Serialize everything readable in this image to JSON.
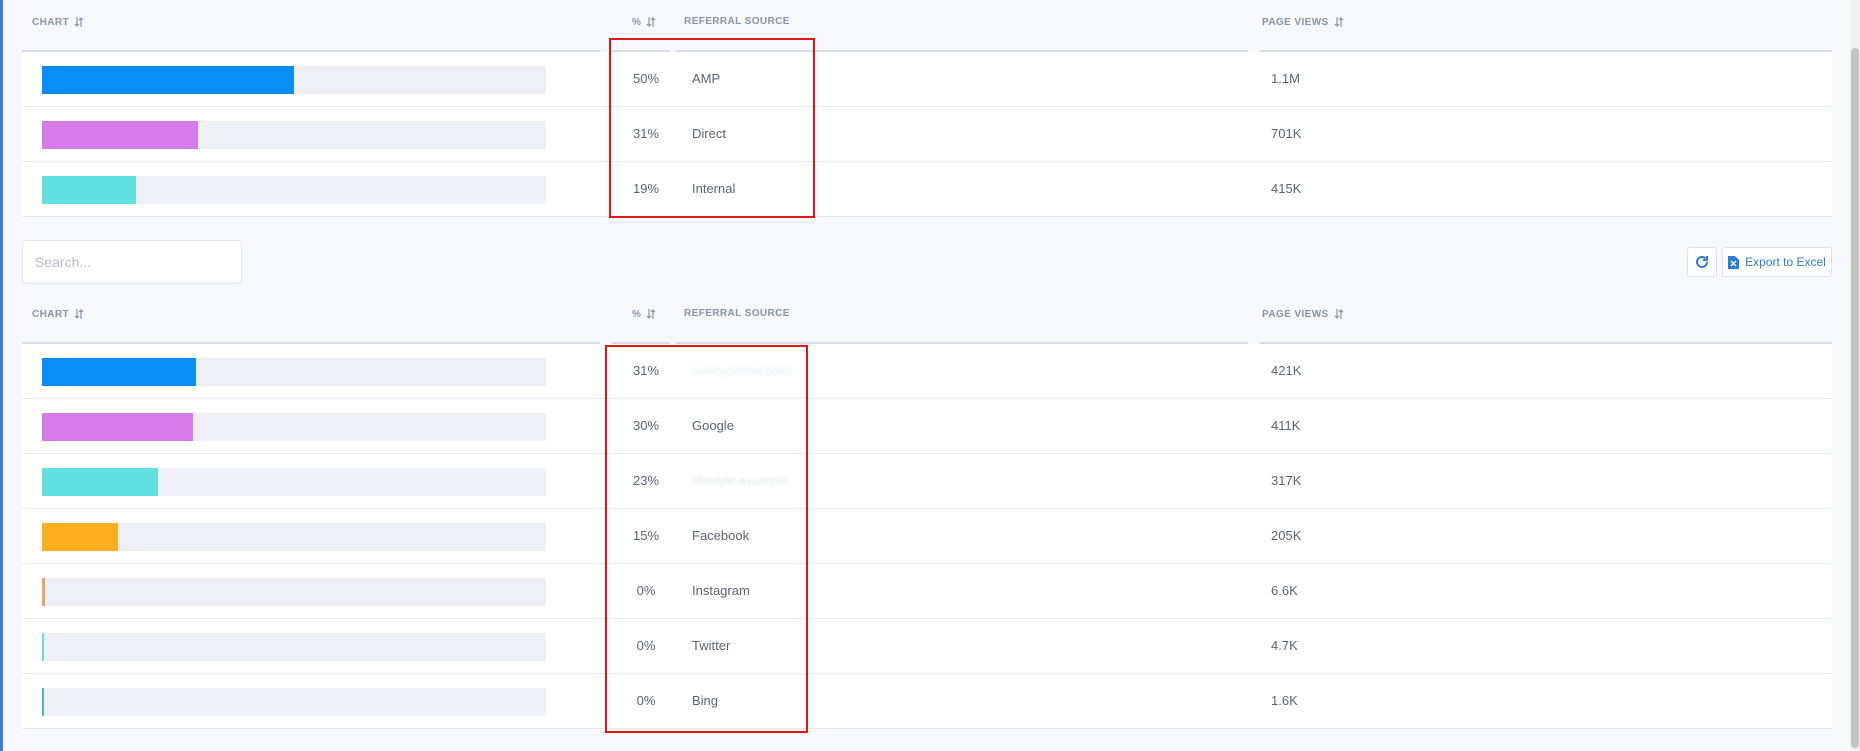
{
  "headers": {
    "chart": "CHART",
    "percent": "%",
    "referral_source": "REFERRAL SOURCE",
    "page_views": "PAGE VIEWS"
  },
  "top_table": {
    "rows": [
      {
        "percent": "50%",
        "source": "AMP",
        "views": "1.1M",
        "fill": 0.5,
        "color": "#0a8ef5"
      },
      {
        "percent": "31%",
        "source": "Direct",
        "views": "701K",
        "fill": 0.31,
        "color": "#d77bea"
      },
      {
        "percent": "19%",
        "source": "Internal",
        "views": "415K",
        "fill": 0.187,
        "color": "#62e0e0"
      }
    ]
  },
  "toolbar": {
    "search_placeholder": "Search...",
    "export_label": "Export to Excel"
  },
  "bottom_table": {
    "rows": [
      {
        "percent": "31%",
        "source": "sunnyconfections",
        "views": "421K",
        "fill": 0.306,
        "color": "#0a8ef5",
        "redacted": true
      },
      {
        "percent": "30%",
        "source": "Google",
        "views": "411K",
        "fill": 0.3,
        "color": "#d77bea"
      },
      {
        "percent": "23%",
        "source": "lifestyle.example",
        "views": "317K",
        "fill": 0.23,
        "color": "#62e0e0",
        "redacted": true
      },
      {
        "percent": "15%",
        "source": "Facebook",
        "views": "205K",
        "fill": 0.15,
        "color": "#ffae1f"
      },
      {
        "percent": "0%",
        "source": "Instagram",
        "views": "6.6K",
        "fill": 0.005,
        "color": "#f0a060"
      },
      {
        "percent": "0%",
        "source": "Twitter",
        "views": "4.7K",
        "fill": 0.004,
        "color": "#62e0e0"
      },
      {
        "percent": "0%",
        "source": "Bing",
        "views": "1.6K",
        "fill": 0.003,
        "color": "#41b8e6"
      }
    ]
  },
  "colors": {
    "highlight": "#e01515",
    "accent": "#2e7bd6"
  },
  "icons": {
    "sort": "sort-icon",
    "refresh": "refresh-icon",
    "excel": "excel-file-icon"
  }
}
